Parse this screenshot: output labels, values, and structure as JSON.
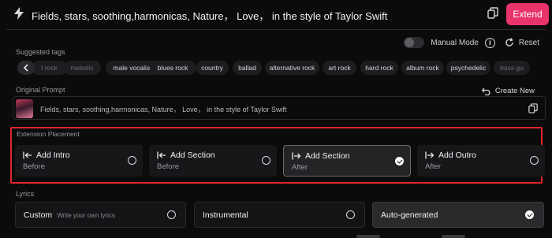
{
  "header": {
    "prompt": "Fields, stars, soothing,harmonicas, Nature， Love， in the style of Taylor Swift",
    "extend_label": "Extend"
  },
  "controls": {
    "manual_mode_label": "Manual Mode",
    "manual_mode_on": false,
    "reset_label": "Reset"
  },
  "suggested_tags": {
    "label": "Suggested tags",
    "items": [
      "t rock",
      "melodic",
      "male vocalist",
      "blues rock",
      "country",
      "ballad",
      "alternative rock",
      "art rock",
      "hard rock",
      "album rock",
      "psychedelic",
      "bass gu"
    ]
  },
  "original_prompt": {
    "label": "Original Prompt",
    "create_new_label": "Create New",
    "text": "Fields, stars, soothing,harmonicas, Nature， Love， in the style of Taylor Swift"
  },
  "extension_placement": {
    "label": "Extension Placement",
    "options": [
      {
        "title": "Add Intro",
        "sub": "Before",
        "icon": "arrow-left-bar-icon",
        "selected": false
      },
      {
        "title": "Add Section",
        "sub": "Before",
        "icon": "arrow-left-bar-icon",
        "selected": false
      },
      {
        "title": "Add Section",
        "sub": "After",
        "icon": "arrow-right-bar-icon",
        "selected": true
      },
      {
        "title": "Add Outro",
        "sub": "After",
        "icon": "arrow-right-bar-icon",
        "selected": false
      }
    ]
  },
  "lyrics": {
    "label": "Lyrics",
    "options": [
      {
        "title": "Custom",
        "hint": "Write your own lyrics",
        "selected": false
      },
      {
        "title": "Instrumental",
        "hint": "",
        "selected": false
      },
      {
        "title": "Auto-generated",
        "hint": "",
        "selected": true
      }
    ]
  },
  "colors": {
    "accent": "#e8336b",
    "highlight_border": "#e0262b",
    "background": "#0b0b0c"
  }
}
